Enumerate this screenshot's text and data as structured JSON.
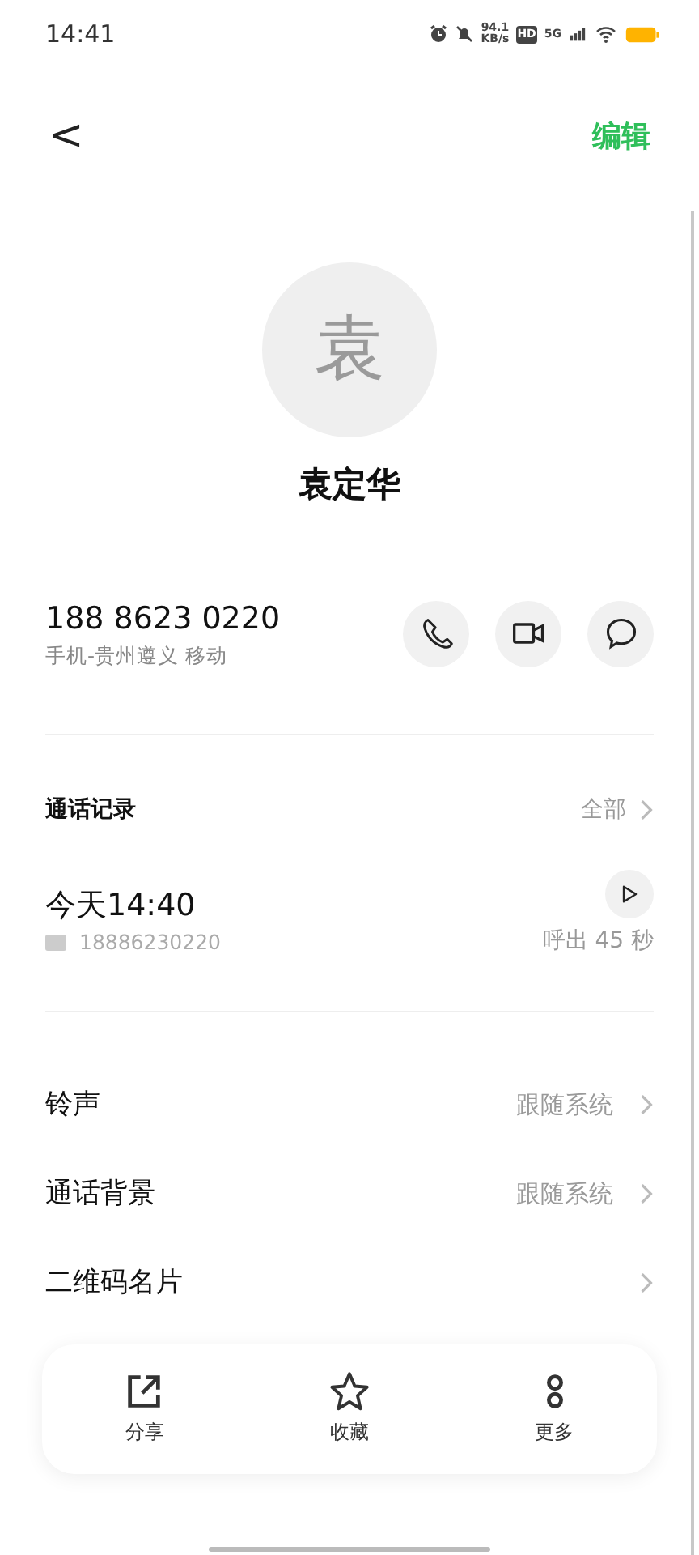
{
  "status_bar": {
    "time": "14:41",
    "net_speed": "94.1",
    "net_unit": "KB/s",
    "hd": "HD",
    "network": "5G"
  },
  "header": {
    "back": "<",
    "edit": "编辑"
  },
  "contact": {
    "avatar": "袁",
    "name": "袁定华"
  },
  "phone": {
    "number": "188 8623 0220",
    "detail": "手机-贵州遵义 移动"
  },
  "actions": [
    {
      "kind": "call"
    },
    {
      "kind": "video"
    },
    {
      "kind": "message"
    }
  ],
  "call_log": {
    "title": "通话记录",
    "all": "全部",
    "entries": [
      {
        "time": "今天14:40",
        "number": "18886230220",
        "result": "呼出 45 秒"
      }
    ]
  },
  "settings": [
    {
      "label": "铃声",
      "value": "跟随系统"
    },
    {
      "label": "通话背景",
      "value": "跟随系统"
    },
    {
      "label": "二维码名片"
    }
  ],
  "bottom_bar": [
    {
      "kind": "share",
      "label": "分享"
    },
    {
      "kind": "favorite",
      "label": "收藏"
    },
    {
      "kind": "more",
      "label": "更多"
    }
  ]
}
